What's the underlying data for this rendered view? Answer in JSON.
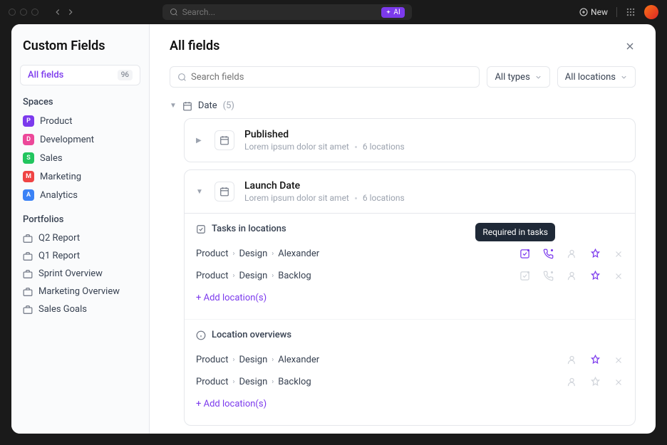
{
  "titlebar": {
    "search_placeholder": "Search...",
    "ai_label": "AI",
    "new_label": "New"
  },
  "sidebar": {
    "title": "Custom Fields",
    "all_fields": {
      "label": "All fields",
      "count": "96"
    },
    "spaces_label": "Spaces",
    "spaces": [
      {
        "letter": "P",
        "color": "#7c3aed",
        "name": "Product"
      },
      {
        "letter": "D",
        "color": "#ec4899",
        "name": "Development"
      },
      {
        "letter": "S",
        "color": "#22c55e",
        "name": "Sales"
      },
      {
        "letter": "M",
        "color": "#ef4444",
        "name": "Marketing"
      },
      {
        "letter": "A",
        "color": "#3b82f6",
        "name": "Analytics"
      }
    ],
    "portfolios_label": "Portfolios",
    "portfolios": [
      {
        "name": "Q2 Report"
      },
      {
        "name": "Q1 Report"
      },
      {
        "name": "Sprint Overview"
      },
      {
        "name": "Marketing Overview"
      },
      {
        "name": "Sales Goals"
      }
    ]
  },
  "main": {
    "title": "All fields",
    "search_placeholder": "Search fields",
    "dropdowns": {
      "types": "All types",
      "locations": "All locations"
    },
    "group": {
      "name": "Date",
      "count": "(5)"
    },
    "fields": [
      {
        "name": "Published",
        "desc": "Lorem ipsum dolor sit amet",
        "locations": "6 locations"
      },
      {
        "name": "Launch Date",
        "desc": "Lorem ipsum dolor sit amet",
        "locations": "6 locations"
      }
    ],
    "expanded": {
      "tasks_header": "Tasks in locations",
      "overview_header": "Location overviews",
      "tooltip": "Required in tasks",
      "rows": [
        {
          "p1": "Product",
          "p2": "Design",
          "p3": "Alexander"
        },
        {
          "p1": "Product",
          "p2": "Design",
          "p3": "Backlog"
        }
      ],
      "overview_rows": [
        {
          "p1": "Product",
          "p2": "Design",
          "p3": "Alexander"
        },
        {
          "p1": "Product",
          "p2": "Design",
          "p3": "Backlog"
        }
      ],
      "add_location": "+ Add location(s)"
    }
  }
}
